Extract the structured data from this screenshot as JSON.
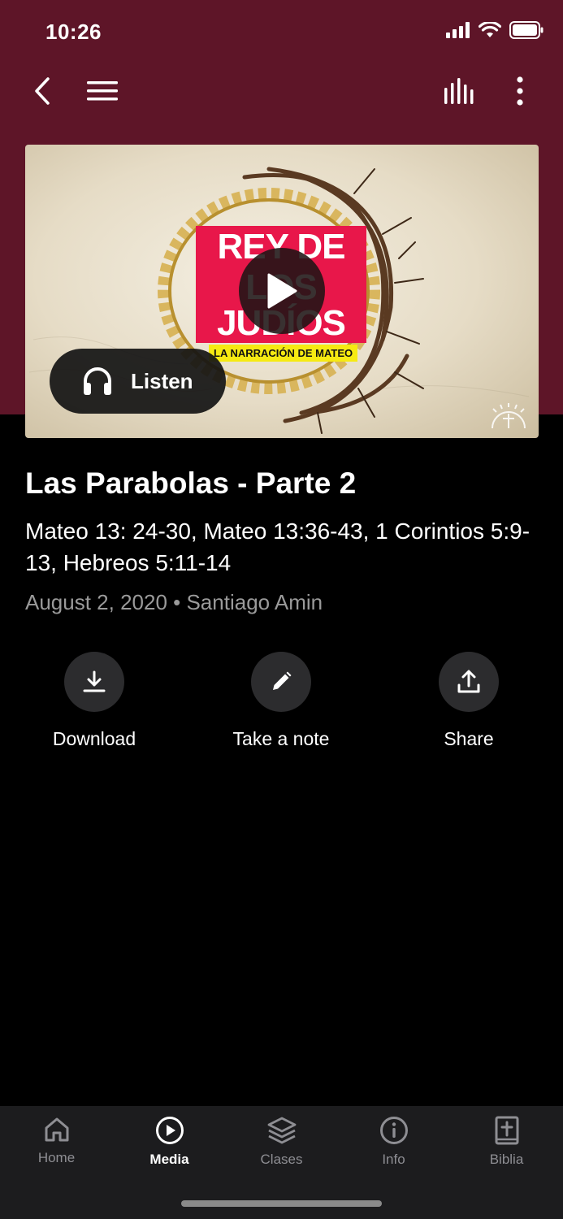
{
  "status_bar": {
    "time": "10:26"
  },
  "hero": {
    "title_line1": "REY DE",
    "title_line2": "LOS JUDÍOS",
    "subtitle": "LA NARRACIÓN DE MATEO",
    "listen_label": "Listen"
  },
  "sermon": {
    "title": "Las Parabolas - Parte 2",
    "references": "Mateo 13: 24-30, Mateo 13:36-43, 1 Corintios 5:9-13, Hebreos 5:11-14",
    "meta": "August 2, 2020 • Santiago Amin"
  },
  "actions": [
    {
      "label": "Download",
      "icon": "download-icon"
    },
    {
      "label": "Take a note",
      "icon": "pencil-icon"
    },
    {
      "label": "Share",
      "icon": "share-icon"
    }
  ],
  "tabs": [
    {
      "label": "Home",
      "icon": "home-icon",
      "active": false
    },
    {
      "label": "Media",
      "icon": "play-circle-icon",
      "active": true
    },
    {
      "label": "Clases",
      "icon": "layers-icon",
      "active": false
    },
    {
      "label": "Info",
      "icon": "info-icon",
      "active": false
    },
    {
      "label": "Biblia",
      "icon": "bible-icon",
      "active": false
    }
  ],
  "colors": {
    "header": "#5e1528",
    "background": "#000000",
    "tabbar": "#1c1c1e",
    "accent_pink": "#e8174a",
    "accent_yellow": "#f6ea12"
  }
}
